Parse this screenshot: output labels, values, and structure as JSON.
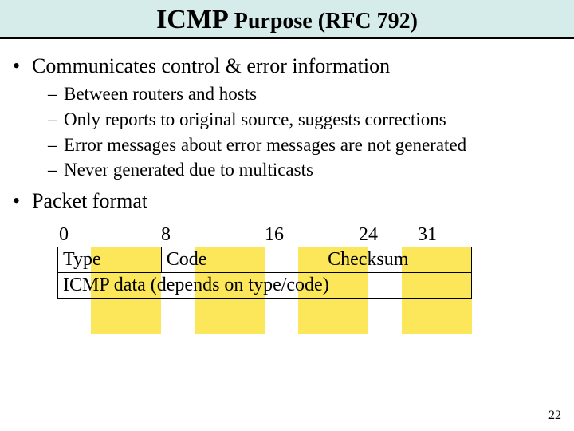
{
  "title": {
    "strong": "ICMP",
    "rest": " Purpose (RFC 792)"
  },
  "bullets": [
    {
      "text": "Communicates control & error information",
      "sub": [
        "Between routers and hosts",
        "Only reports to original source, suggests corrections",
        "Error messages about error messages are not generated",
        "Never generated due to multicasts"
      ]
    },
    {
      "text": "Packet format",
      "sub": []
    }
  ],
  "packet": {
    "ticks": [
      "0",
      "8",
      "16",
      "24",
      "31"
    ],
    "row1": [
      "Type",
      "Code",
      "Checksum"
    ],
    "row2": "ICMP data (depends on type/code)"
  },
  "page_number": "22"
}
